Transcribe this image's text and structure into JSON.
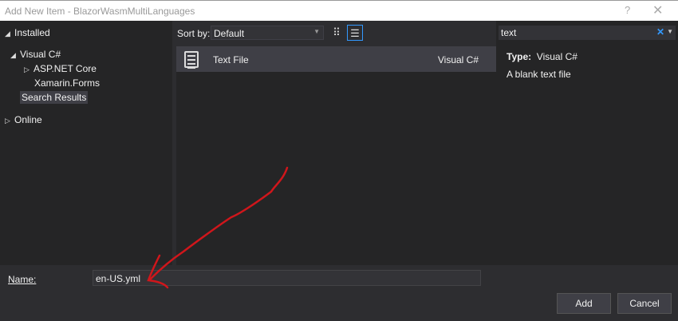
{
  "window": {
    "title": "Add New Item - BlazorWasmMultiLanguages",
    "help": "?",
    "close": "✕"
  },
  "tree": {
    "installed": "Installed",
    "visual_csharp": "Visual C#",
    "aspnet_core": "ASP.NET Core",
    "xamarin_forms": "Xamarin.Forms",
    "search_results": "Search Results",
    "online": "Online"
  },
  "toolbar": {
    "sort_label": "Sort by:",
    "sort_value": "Default"
  },
  "items": [
    {
      "name": "Text File",
      "type": "Visual C#"
    }
  ],
  "search": {
    "value": "text"
  },
  "details": {
    "type_label": "Type:",
    "type_value": "Visual C#",
    "description": "A blank text file"
  },
  "footer": {
    "name_label": "Name:",
    "name_value": "en-US.yml",
    "add": "Add",
    "cancel": "Cancel"
  },
  "annotation_color": "#d0161b"
}
